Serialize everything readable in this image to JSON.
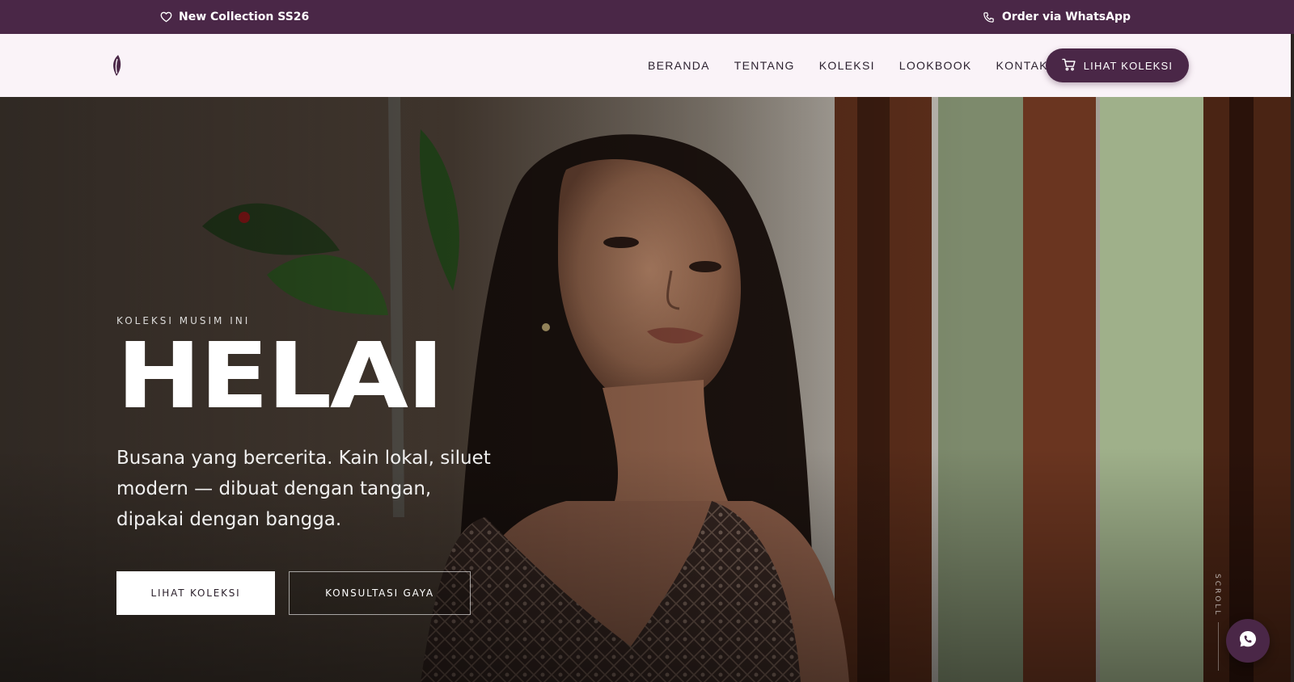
{
  "topbar": {
    "announcement": "New Collection SS26",
    "announcement_icon": "heart-icon",
    "order_link": "Order via WhatsApp",
    "order_icon": "phone-icon"
  },
  "nav": {
    "logo_icon": "leaf-logo-icon",
    "links": [
      "BERANDA",
      "TENTANG",
      "KOLEKSI",
      "LOOKBOOK",
      "KONTAK"
    ],
    "cta_label": "LIHAT KOLEKSI",
    "cta_icon": "cart-icon"
  },
  "hero": {
    "eyebrow": "KOLEKSI MUSIM INI",
    "title": "HELAI",
    "subtitle": "Busana yang bercerita. Kain lokal, siluet modern — dibuat dengan tangan, dipakai dengan bangga.",
    "primary_button": "LIHAT KOLEKSI",
    "secondary_button": "KONSULTASI GAYA",
    "scroll_label": "SCROLL",
    "floating_icon": "whatsapp-icon"
  },
  "colors": {
    "brand": "#4a2747",
    "nav_background": "#faf3f8",
    "text_light": "#ffffff"
  }
}
